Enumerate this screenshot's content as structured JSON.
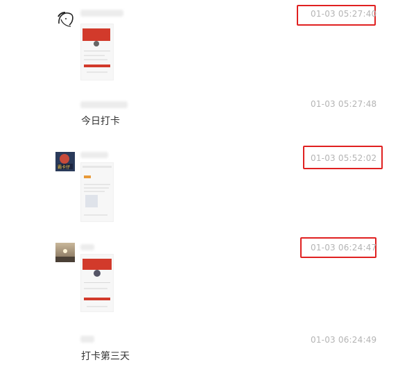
{
  "messages": [
    {
      "timestamp": "01-03 05:27:40",
      "highlighted": true
    },
    {
      "timestamp": "01-03 05:27:48",
      "text": "今日打卡",
      "highlighted": false
    },
    {
      "timestamp": "01-03 05:52:02",
      "highlighted": true
    },
    {
      "timestamp": "01-03 06:24:47",
      "highlighted": true
    },
    {
      "timestamp": "01-03 06:24:49",
      "text": "打卡第三天",
      "highlighted": false
    }
  ],
  "avatars": {
    "first": {
      "icon": "sketch-portrait-icon"
    },
    "second": {
      "icon": "red-badge-photo-icon",
      "label": "霸卡仔"
    },
    "third": {
      "icon": "sunrise-photo-icon"
    }
  },
  "colors": {
    "highlight_border": "#e02020",
    "timestamp": "#b4b4b4",
    "accent_red": "#d23a2b"
  }
}
